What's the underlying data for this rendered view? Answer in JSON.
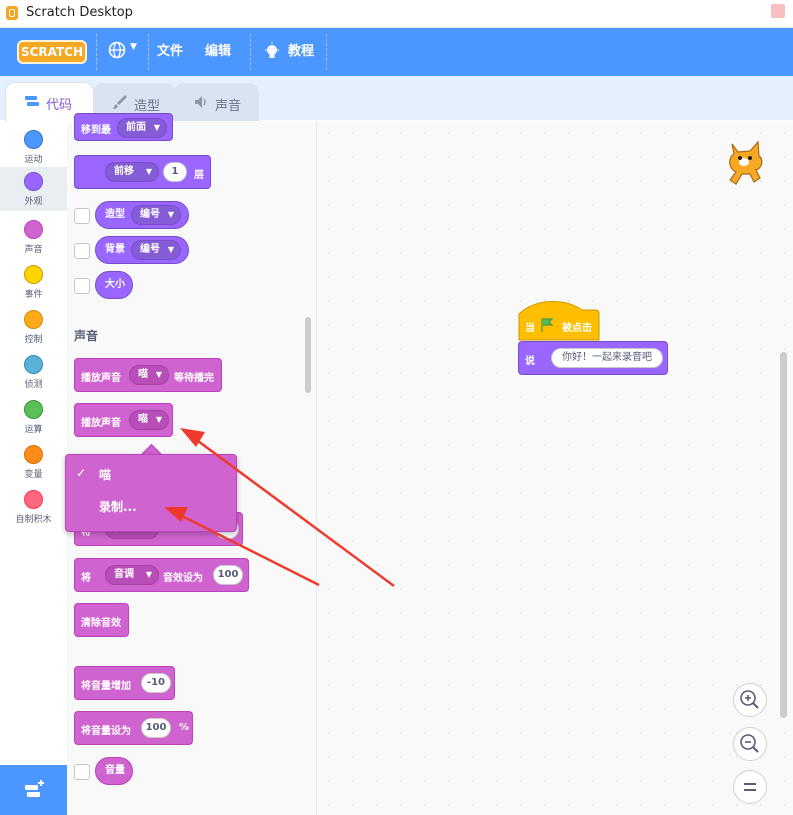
{
  "window": {
    "title": "Scratch Desktop"
  },
  "menubar": {
    "logo_text": "SCRATCH",
    "file_label": "文件",
    "edit_label": "编辑",
    "tutorials_label": "教程"
  },
  "tabs": [
    {
      "label": "代码",
      "icon": "code-icon",
      "active": true
    },
    {
      "label": "造型",
      "icon": "brush-icon",
      "active": false
    },
    {
      "label": "声音",
      "icon": "speaker-icon",
      "active": false
    }
  ],
  "categories": [
    {
      "label": "运动",
      "color": "#4c97ff"
    },
    {
      "label": "外观",
      "color": "#9966ff"
    },
    {
      "label": "声音",
      "color": "#cf63cf"
    },
    {
      "label": "事件",
      "color": "#ffd500"
    },
    {
      "label": "控制",
      "color": "#ffab19"
    },
    {
      "label": "侦测",
      "color": "#5cb1d6"
    },
    {
      "label": "运算",
      "color": "#59c059"
    },
    {
      "label": "变量",
      "color": "#ff8c1a"
    },
    {
      "label": "自制积木",
      "color": "#ff6680"
    }
  ],
  "palette": {
    "looks": {
      "goto_layer": "移到最",
      "goto_layer_option": "前面",
      "move_layer": "前移",
      "move_layer_value": "1",
      "move_layer_suffix": "层",
      "costume_label": "造型",
      "costume_option": "编号",
      "backdrop_label": "背景",
      "backdrop_option": "编号",
      "size_label": "大小"
    },
    "sound_section_title": "声音",
    "sound": {
      "play_until_done": "播放声音",
      "play_until_done_option": "喵",
      "play_until_done_suffix": "等待播完",
      "play": "播放声音",
      "play_option": "喵",
      "set_effect_prefix": "将",
      "set_effect_option": "音调",
      "set_effect_mid": "音效设为",
      "set_effect_value": "100",
      "clear_effects": "清除音效",
      "change_volume": "将音量增加",
      "change_volume_value": "-10",
      "set_volume": "将音量设为",
      "set_volume_value": "100",
      "set_volume_suffix": "%",
      "volume_reporter": "音量",
      "hidden_block_prefix": "将",
      "hidden_block_option": "音调",
      "hidden_block_value": "10"
    }
  },
  "dropdown_menu": {
    "checkmark": "✓",
    "items": [
      {
        "label": "喵",
        "selected": true
      },
      {
        "label": "录制...",
        "selected": false
      }
    ]
  },
  "script": {
    "hat_prefix": "当",
    "hat_suffix": "被点击",
    "say_label": "说",
    "say_text": "你好！一起来录音吧"
  }
}
